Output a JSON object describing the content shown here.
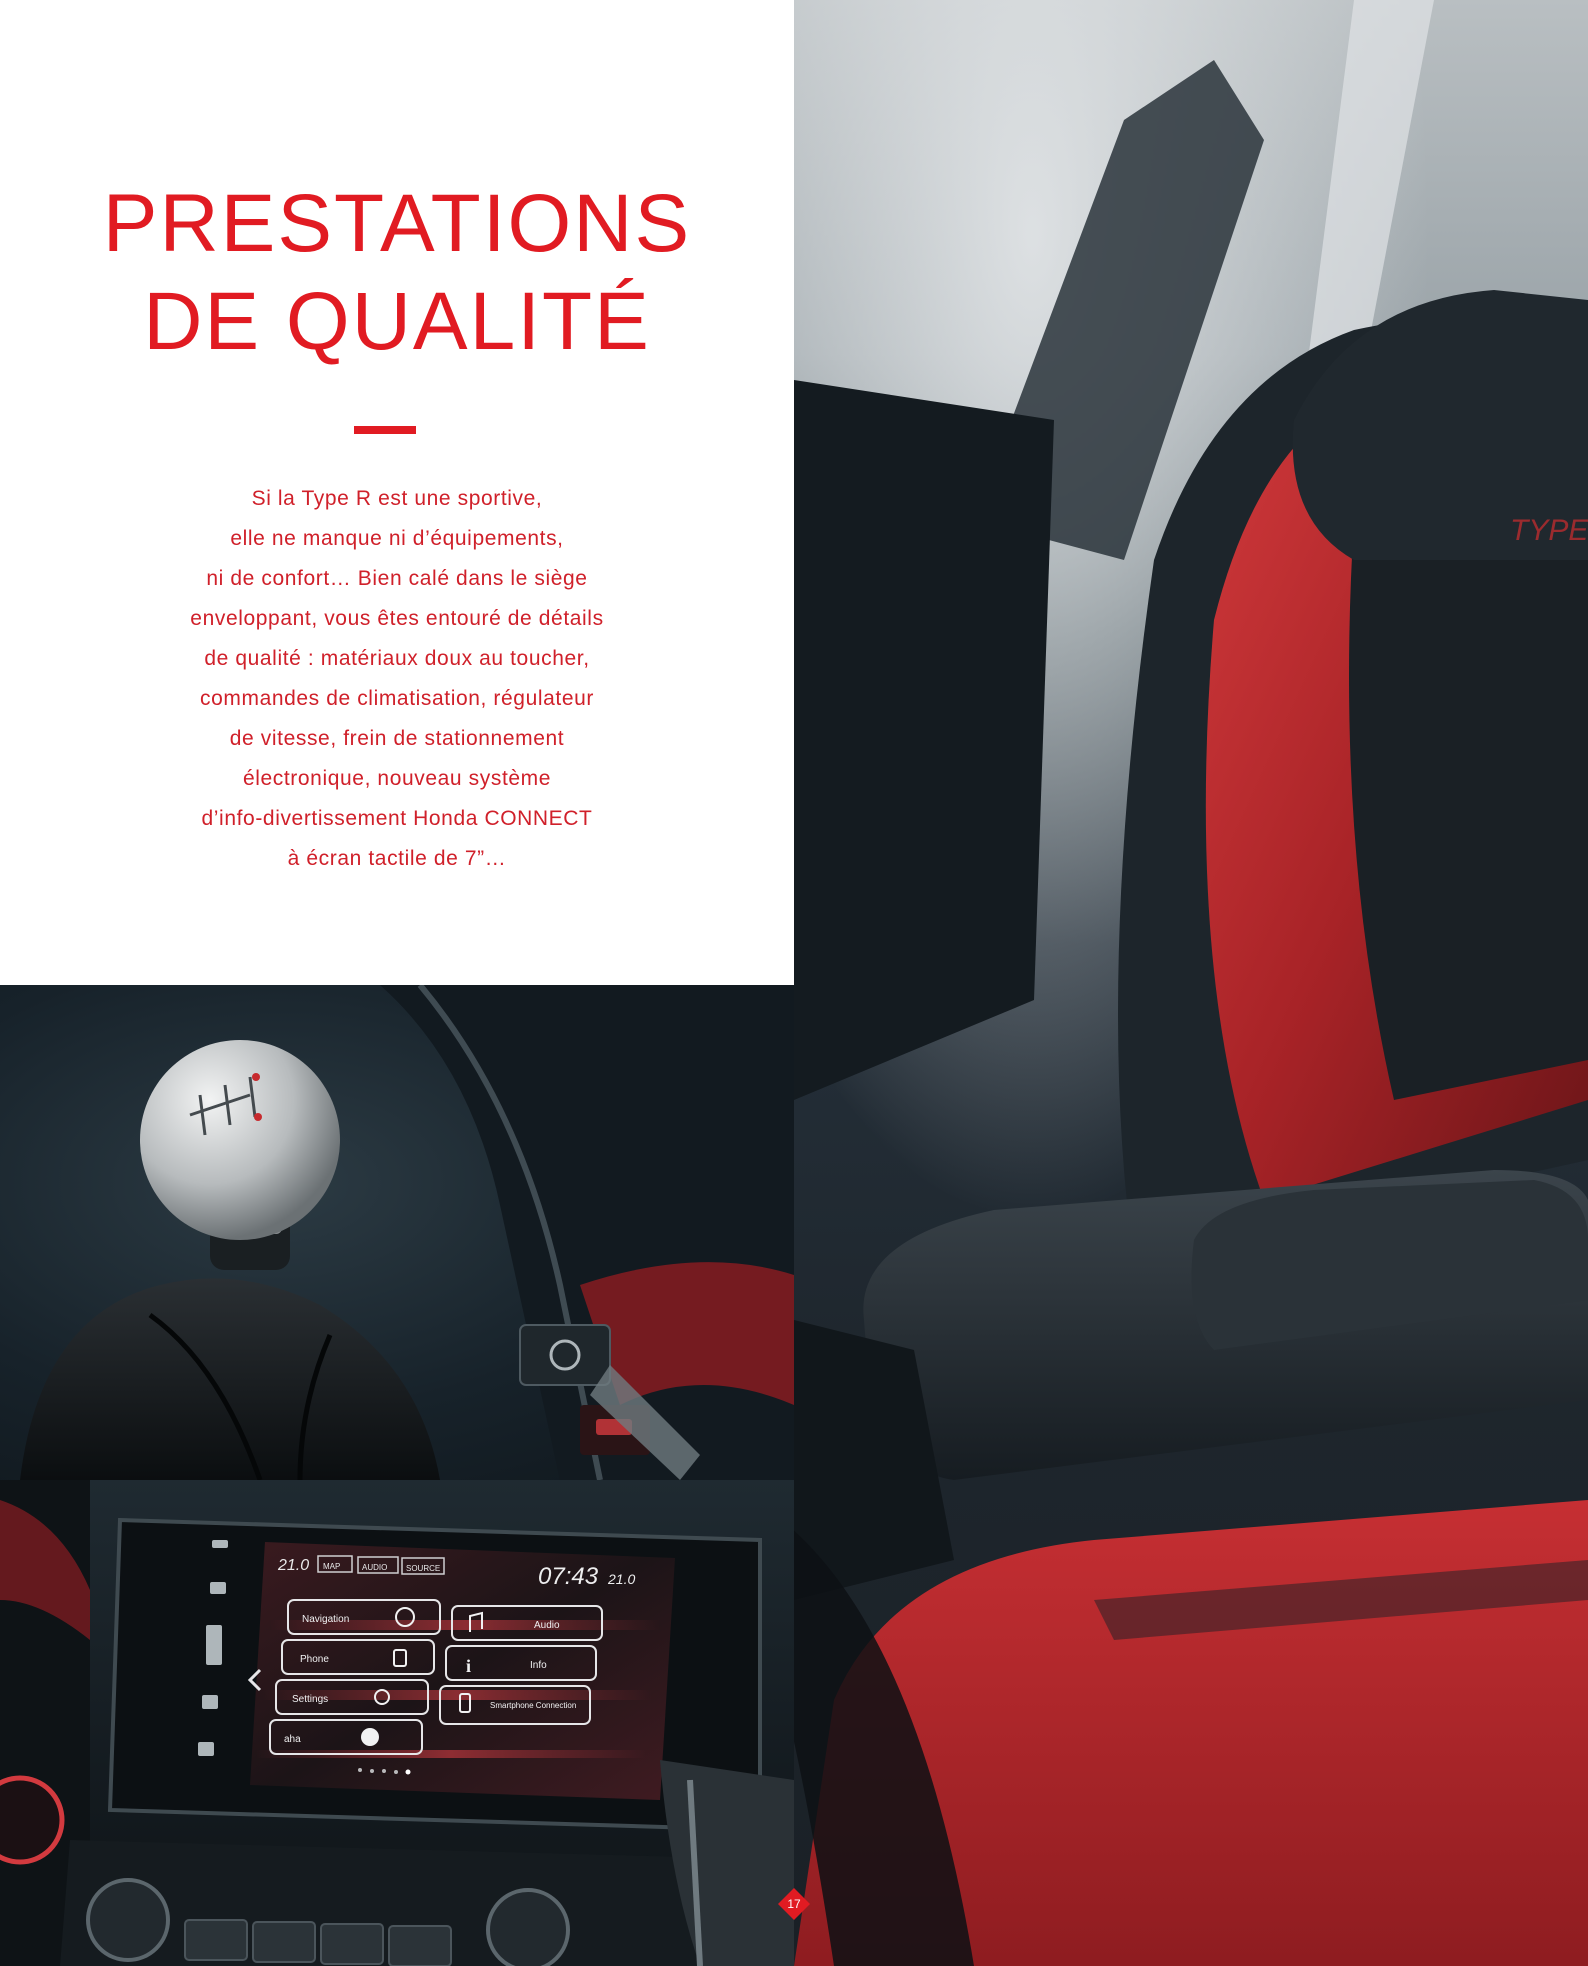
{
  "title": {
    "line1": "PRESTATIONS",
    "line2": "DE QUALITÉ"
  },
  "body": {
    "lines": [
      "Si la Type R est une sportive,",
      "elle ne manque ni d’équipements,",
      "ni de confort… Bien calé dans le siège",
      "enveloppant, vous êtes entouré de détails",
      "de qualité : matériaux doux au toucher,",
      "commandes de climatisation, régulateur",
      "de vitesse, frein de stationnement",
      "électronique, nouveau système",
      "d’info-divertissement Honda CONNECT",
      "à écran tactile de 7”…"
    ]
  },
  "seat_photo": {
    "headrest_logo": "TYPE R"
  },
  "gear_photo": {
    "knob_pattern": "1 3 5 / 2 4 6 R"
  },
  "screen_photo": {
    "status": {
      "temp_left": "21.0",
      "tabs": [
        "MAP",
        "AUDIO",
        "SOURCE"
      ],
      "clock": "07:43",
      "temp_right": "21.0"
    },
    "menu": [
      {
        "label": "Navigation",
        "icon": "compass-icon"
      },
      {
        "label": "Audio",
        "icon": "music-note-icon"
      },
      {
        "label": "Phone",
        "icon": "phone-icon"
      },
      {
        "label": "Info",
        "icon": "info-icon"
      },
      {
        "label": "Settings",
        "icon": "gear-icon"
      },
      {
        "label": "Smartphone Connection",
        "icon": "smartphone-icon"
      },
      {
        "label": "aha",
        "icon": "aha-icon"
      }
    ]
  },
  "page_number": "17",
  "colors": {
    "accent": "#e11b22",
    "seat_red": "#b3262c"
  }
}
